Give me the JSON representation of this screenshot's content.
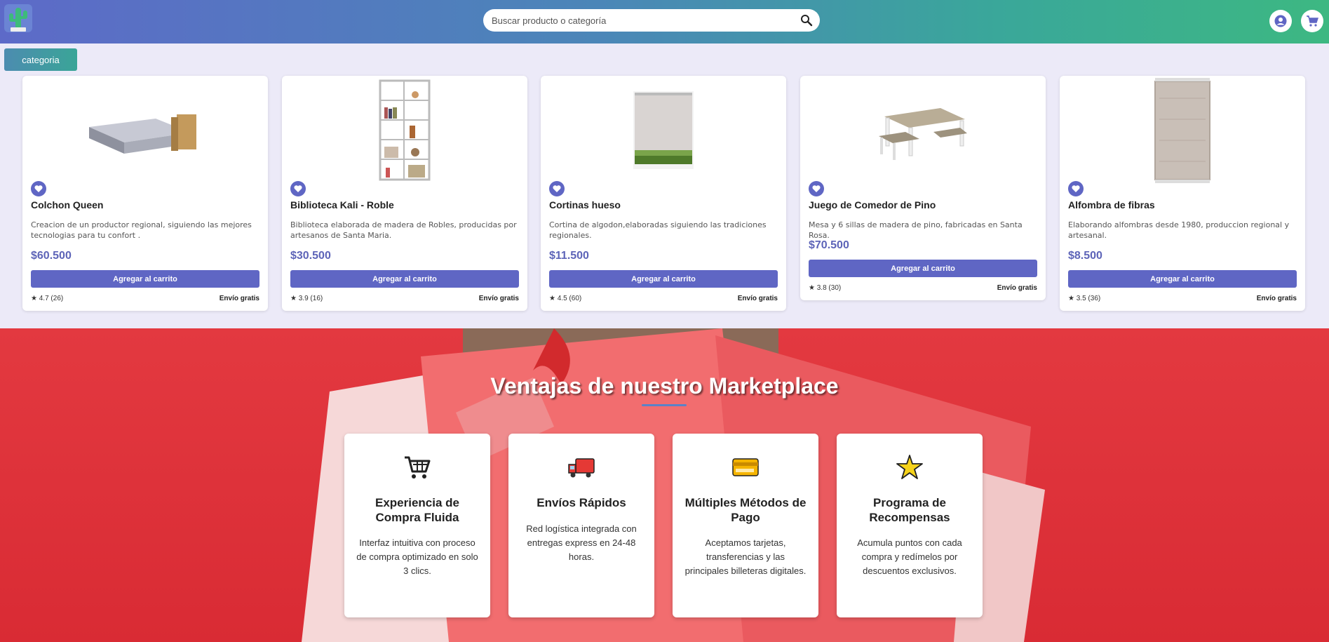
{
  "header": {
    "search_placeholder": "Buscar producto o categoría",
    "logo_icon": "cactus-logo-icon",
    "user_icon": "user-icon",
    "cart_icon": "cart-icon"
  },
  "category_button": "categoria",
  "products": [
    {
      "title": "Colchon Queen",
      "description": "Creacion de un productor regional, siguiendo las mejores tecnologias para tu confort .",
      "price": "$60.500",
      "add_label": "Agregar al carrito",
      "rating": "★ 4.7 (26)",
      "shipping": "Envío gratis"
    },
    {
      "title": "Biblioteca Kali - Roble",
      "description": "Biblioteca elaborada de madera de Robles, producidas por artesanos de Santa Maria.",
      "price": "$30.500",
      "add_label": "Agregar al carrito",
      "rating": "★ 3.9 (16)",
      "shipping": "Envío gratis"
    },
    {
      "title": "Cortinas hueso",
      "description": "Cortina de algodon,elaboradas siguiendo las tradiciones regionales.",
      "price": "$11.500",
      "add_label": "Agregar al carrito",
      "rating": "★ 4.5 (60)",
      "shipping": "Envío gratis"
    },
    {
      "title": "Juego de Comedor de Pino",
      "description": "Mesa y 6 sillas de madera de pino, fabricadas en Santa Rosa.",
      "price": "$70.500",
      "add_label": "Agregar al carrito",
      "rating": "★ 3.8 (30)",
      "shipping": "Envío gratis"
    },
    {
      "title": "Alfombra de fibras",
      "description": "Elaborando alfombras desde 1980, produccion regional y artesanal.",
      "price": "$8.500",
      "add_label": "Agregar al carrito",
      "rating": "★ 3.5 (36)",
      "shipping": "Envío gratis"
    }
  ],
  "advantages": {
    "title": "Ventajas de nuestro Marketplace",
    "items": [
      {
        "icon": "shopping-cart-icon",
        "title": "Experiencia de Compra Fluida",
        "text": "Interfaz intuitiva con proceso de compra optimizado en solo 3 clics."
      },
      {
        "icon": "delivery-truck-icon",
        "title": "Envíos Rápidos",
        "text": "Red logística integrada con entregas express en 24-48 horas."
      },
      {
        "icon": "credit-card-icon",
        "title": "Múltiples Métodos de Pago",
        "text": "Aceptamos tarjetas, transferencias y las principales billeteras digitales."
      },
      {
        "icon": "star-icon",
        "title": "Programa de Recompensas",
        "text": "Acumula puntos con cada compra y redímelos por descuentos exclusivos."
      }
    ]
  },
  "colors": {
    "accent": "#5f66c4",
    "price": "#5d64b8",
    "section_bg": "#e33940"
  }
}
